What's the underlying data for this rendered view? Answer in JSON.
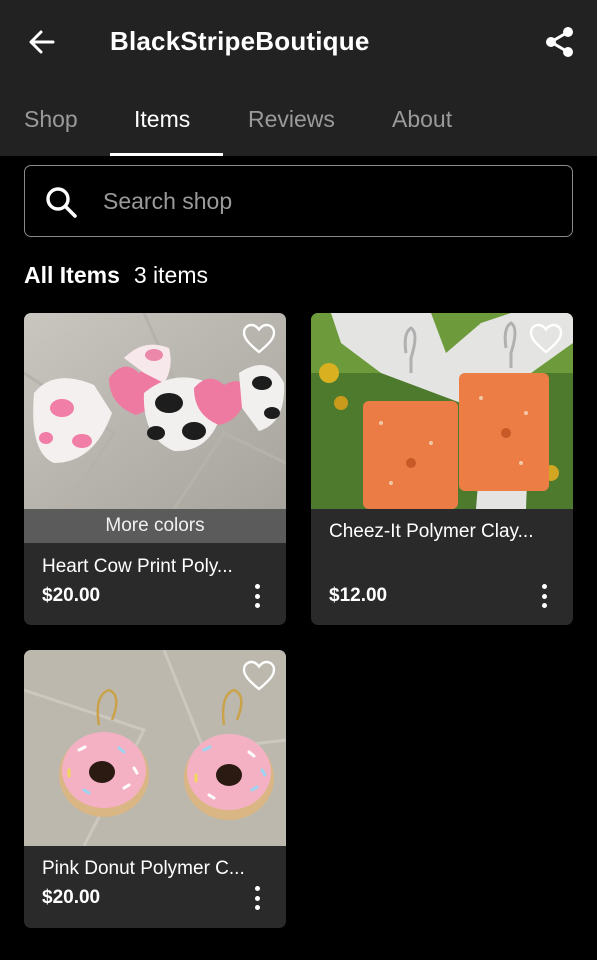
{
  "header": {
    "title": "BlackStripeBoutique",
    "back_icon": "arrow-left-icon",
    "share_icon": "share-icon"
  },
  "tabs": [
    {
      "label": "Shop",
      "active": false
    },
    {
      "label": "Items",
      "active": true
    },
    {
      "label": "Reviews",
      "active": false
    },
    {
      "label": "About",
      "active": false
    }
  ],
  "search": {
    "placeholder": "Search shop",
    "value": "",
    "icon": "search-icon"
  },
  "section": {
    "heading": "All Items",
    "count": "3 items"
  },
  "items": [
    {
      "name": "Heart Cow Print Poly...",
      "price": "$20.00",
      "badge": "More colors",
      "favorite_icon": "heart-outline-icon"
    },
    {
      "name": "Cheez-It Polymer Clay...",
      "price": "$12.00",
      "favorite_icon": "heart-outline-icon"
    },
    {
      "name": "Pink Donut Polymer C...",
      "price": "$20.00",
      "favorite_icon": "heart-outline-icon"
    }
  ],
  "colors": {
    "header_bg": "#222222",
    "card_bg": "#2a2a2a",
    "badge_bg": "#5b5b5b",
    "tab_inactive": "#9a9a9a"
  }
}
